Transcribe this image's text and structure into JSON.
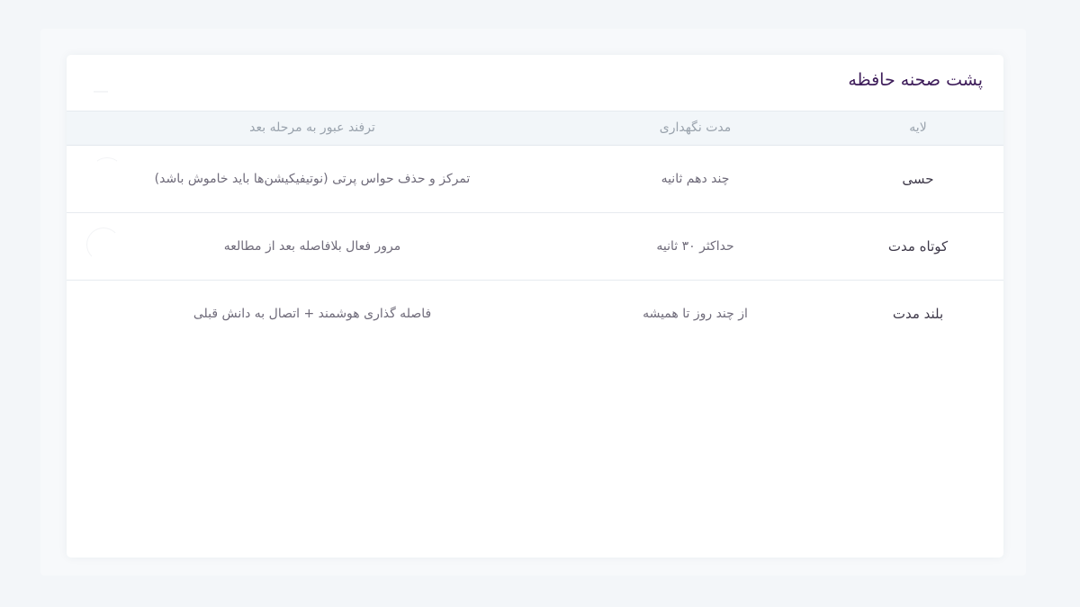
{
  "card": {
    "title": "پشت صحنه حافظه"
  },
  "table": {
    "headers": {
      "layer": "لایه",
      "duration": "مدت نگهداری",
      "tip": "ترفند عبور به مرحله بعد"
    },
    "rows": [
      {
        "layer": "حسی",
        "duration": "چند دهم ثانیه",
        "tip": "تمرکز و حذف حواس پرتی (نوتیفیکیشن‌ها باید خاموش باشد)"
      },
      {
        "layer": "کوتاه مدت",
        "duration": "حداکثر ۳۰ ثانیه",
        "tip": "مرور فعال بلافاصله بعد از مطالعه"
      },
      {
        "layer": "بلند مدت",
        "duration": "از چند روز تا همیشه",
        "tip": "فاصله گذاری هوشمند + اتصال به دانش قبلی"
      }
    ]
  },
  "colors": {
    "page_background": "#f3f6f9",
    "card_background": "#ffffff",
    "header_row_background": "#f2f6f9",
    "title": "#3e1d5a",
    "layer_text": "#3f3a4a",
    "body_text": "#6f6b7a",
    "header_text": "#9aa3ad"
  }
}
